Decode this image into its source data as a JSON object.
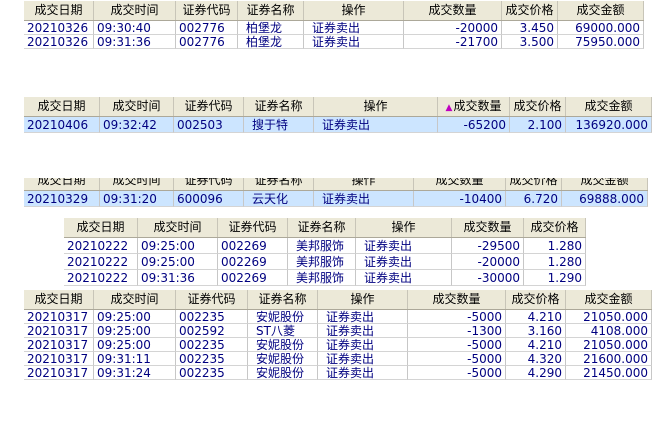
{
  "table1": {
    "headers": [
      "成交日期",
      "成交时间",
      "证券代码",
      "证券名称",
      "操作",
      "成交数量",
      "成交价格",
      "成交金额"
    ],
    "rows": [
      [
        "20210326",
        "09:30:40",
        "002776",
        "柏堡龙",
        "证券卖出",
        "-20000",
        "3.450",
        "69000.000"
      ],
      [
        "20210326",
        "09:31:36",
        "002776",
        "柏堡龙",
        "证券卖出",
        "-21700",
        "3.500",
        "75950.000"
      ]
    ]
  },
  "table2": {
    "headers": [
      "成交日期",
      "成交时间",
      "证券代码",
      "证券名称",
      "操作",
      "成交数量",
      "成交价格",
      "成交金额"
    ],
    "sort_indicator": "▲",
    "rows": [
      [
        "20210406",
        "09:32:42",
        "002503",
        "搜于特",
        "证券卖出",
        "-65200",
        "2.100",
        "136920.000"
      ]
    ]
  },
  "table3": {
    "headers": [
      "成交日期",
      "成交时间",
      "证券代码",
      "证券名称",
      "操作",
      "成交数量",
      "成交价格",
      "成交金额"
    ],
    "rows": [
      [
        "20210329",
        "09:31:20",
        "600096",
        "云天化",
        "证券卖出",
        "-10400",
        "6.720",
        "69888.000"
      ]
    ]
  },
  "table4": {
    "headers": [
      "成交日期",
      "成交时间",
      "证券代码",
      "证券名称",
      "操作",
      "成交数量",
      "成交价格"
    ],
    "rows": [
      [
        "20210222",
        "09:25:00",
        "002269",
        "美邦服饰",
        "证券卖出",
        "-29500",
        "1.280"
      ],
      [
        "20210222",
        "09:25:00",
        "002269",
        "美邦服饰",
        "证券卖出",
        "-20000",
        "1.280"
      ],
      [
        "20210222",
        "09:31:36",
        "002269",
        "美邦服饰",
        "证券卖出",
        "-30000",
        "1.290"
      ]
    ]
  },
  "table5": {
    "headers": [
      "成交日期",
      "成交时间",
      "证券代码",
      "证券名称",
      "操作",
      "成交数量",
      "成交价格",
      "成交金额"
    ],
    "rows": [
      [
        "20210317",
        "09:25:00",
        "002235",
        "安妮股份",
        "证券卖出",
        "-5000",
        "4.210",
        "21050.000"
      ],
      [
        "20210317",
        "09:25:00",
        "002592",
        "ST八菱",
        "证券卖出",
        "-1300",
        "3.160",
        "4108.000"
      ],
      [
        "20210317",
        "09:25:00",
        "002235",
        "安妮股份",
        "证券卖出",
        "-5000",
        "4.210",
        "21050.000"
      ],
      [
        "20210317",
        "09:31:11",
        "002235",
        "安妮股份",
        "证券卖出",
        "-5000",
        "4.320",
        "21600.000"
      ],
      [
        "20210317",
        "09:31:24",
        "002235",
        "安妮股份",
        "证券卖出",
        "-5000",
        "4.290",
        "21450.000"
      ]
    ]
  },
  "colors": {
    "selected_row": "#cce5ff",
    "cell_text": "#000080",
    "header_bg": "#ece9d8"
  }
}
